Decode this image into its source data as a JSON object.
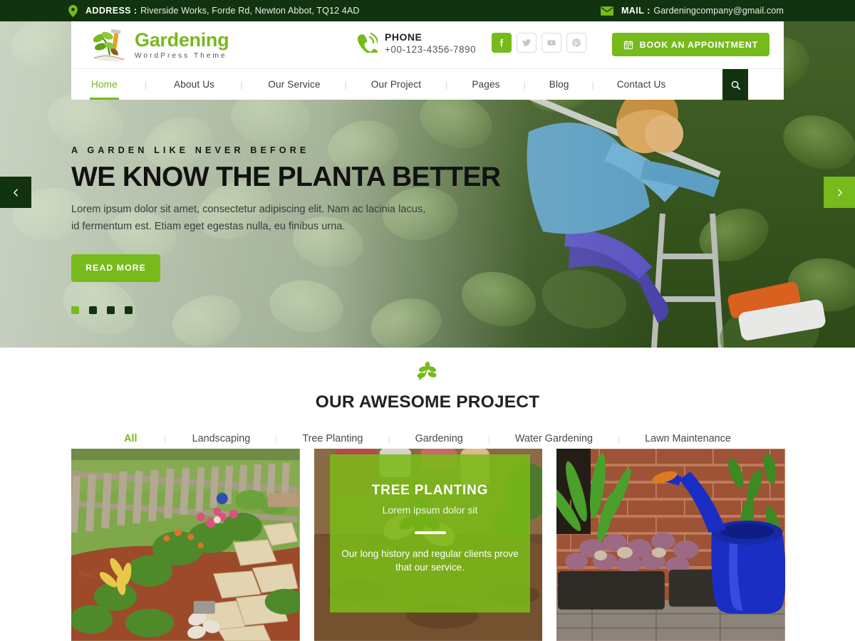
{
  "topbar": {
    "address_icon": "location-pin-icon",
    "address_label": "ADDRESS",
    "colon": ":",
    "address_value": "Riverside Works, Forde Rd, Newton Abbot, TQ12 4AD",
    "mail_icon": "envelope-icon",
    "mail_label": "MAIL",
    "mail_value": "Gardeningcompany@gmail.com"
  },
  "header": {
    "logo": {
      "icon": "plant-shovel-icon",
      "title": "Gardening",
      "subtitle": "WordPress Theme"
    },
    "phone": {
      "icon": "phone-ringing-icon",
      "label": "PHONE",
      "number": "+00-123-4356-7890"
    },
    "socials": [
      {
        "name": "facebook-icon",
        "glyph": "f",
        "active": true
      },
      {
        "name": "twitter-icon",
        "glyph": "t",
        "active": false
      },
      {
        "name": "youtube-icon",
        "glyph": "y",
        "active": false
      },
      {
        "name": "pinterest-icon",
        "glyph": "P",
        "active": false
      }
    ],
    "book_button": {
      "icon": "calendar-icon",
      "label": "BOOK AN APPOINTMENT"
    },
    "nav": [
      {
        "label": "Home",
        "active": true
      },
      {
        "label": "About Us",
        "active": false
      },
      {
        "label": "Our Service",
        "active": false
      },
      {
        "label": "Our Project",
        "active": false
      },
      {
        "label": "Pages",
        "active": false
      },
      {
        "label": "Blog",
        "active": false
      },
      {
        "label": "Contact Us",
        "active": false
      }
    ],
    "nav_separator": "|",
    "search_icon": "search-icon"
  },
  "hero": {
    "eyebrow": "A GARDEN LIKE NEVER BEFORE",
    "title": "WE KNOW THE PLANTA BETTER",
    "description": "Lorem ipsum dolor sit amet, consectetur adipiscing elit. Nam ac lacinia lacus, id fermentum est. Etiam eget egestas nulla, eu finibus urna.",
    "button_label": "READ MORE",
    "prev_icon": "chevron-left-icon",
    "next_icon": "chevron-right-icon",
    "dots": [
      {
        "active": true
      },
      {
        "active": false
      },
      {
        "active": false
      },
      {
        "active": false
      }
    ]
  },
  "projects": {
    "ornament_icon": "leaf-branch-icon",
    "title": "OUR AWESOME PROJECT",
    "filter_separator": "|",
    "filters": [
      {
        "label": "All",
        "active": true
      },
      {
        "label": "Landscaping",
        "active": false
      },
      {
        "label": "Tree Planting",
        "active": false
      },
      {
        "label": "Gardening",
        "active": false
      },
      {
        "label": "Water Gardening",
        "active": false
      },
      {
        "label": "Lawn Maintenance",
        "active": false
      }
    ],
    "cards": [
      {
        "alt": "garden-path-with-picket-fence",
        "overlay": null
      },
      {
        "alt": "tree-planting-hands-in-soil",
        "overlay": {
          "title": "TREE PLANTING",
          "subtitle": "Lorem ipsum dolor sit",
          "description": "Our long history and regular clients prove that our service."
        }
      },
      {
        "alt": "blue-watering-can-by-brick-wall",
        "overlay": null
      }
    ]
  },
  "colors": {
    "brand_green": "#76ba1b",
    "dark_green": "#12330f",
    "text_dark": "#222222",
    "muted": "#555555"
  }
}
